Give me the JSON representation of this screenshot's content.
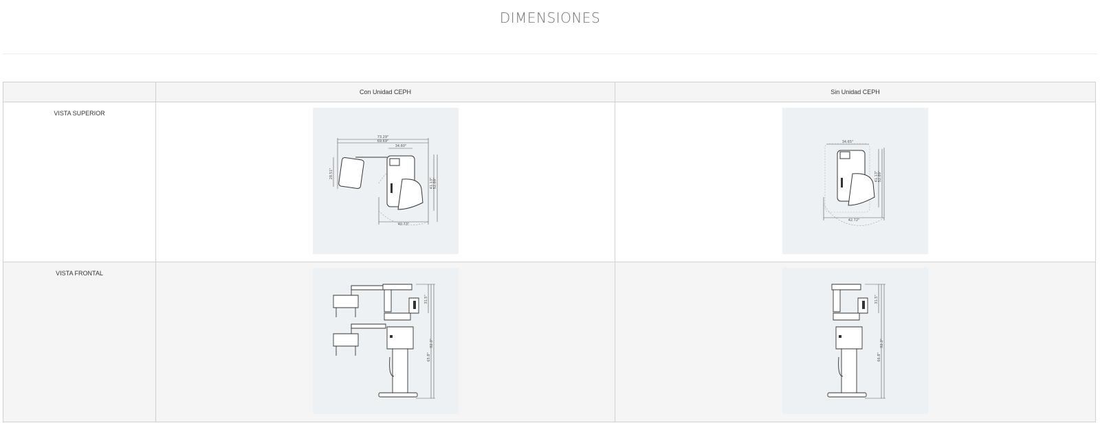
{
  "page": {
    "title": "DIMENSIONES"
  },
  "table": {
    "headers": [
      "",
      "Con Unidad CEPH",
      "Sin Unidad CEPH"
    ],
    "rows": [
      {
        "label": "VISTA SUPERIOR"
      },
      {
        "label": "VISTA FRONTAL"
      }
    ]
  },
  "drawings": {
    "top_ceph": {
      "w_total": "73.29\"",
      "w_mid": "69.69\"",
      "w_arm": "34.60\"",
      "h_panel": "28.51\"",
      "d1": "41.13\"",
      "d2": "52.89\"",
      "w_base": "42.73\""
    },
    "top_noceph": {
      "w_arm": "34.65\"",
      "d1": "41.13\"",
      "d2": "52.89\"",
      "w_base": "42.72\""
    },
    "front_ceph": {
      "h_head": "31.5\"",
      "h_col": "92.3\"",
      "h_total": "65.8\""
    },
    "front_noceph": {
      "h_head": "31.5\"",
      "h_col": "92.3\"",
      "h_total": "66.8\""
    }
  }
}
